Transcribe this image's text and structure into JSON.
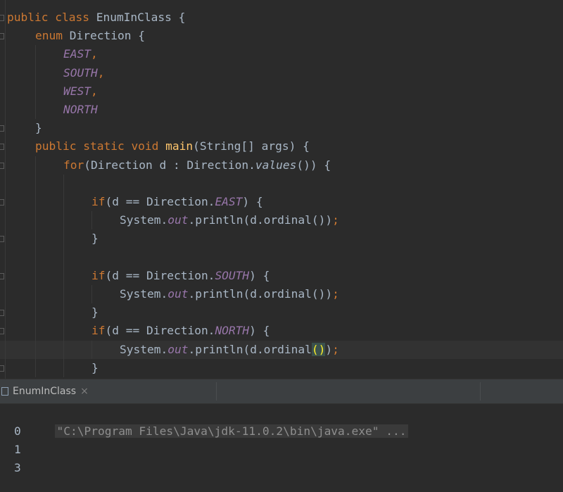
{
  "editor": {
    "lines": [
      {
        "indent": 0,
        "parts": [
          {
            "t": "public class ",
            "c": "kw"
          },
          {
            "t": "EnumInClass {",
            "c": ""
          }
        ]
      },
      {
        "indent": 1,
        "parts": [
          {
            "t": "enum ",
            "c": "kw"
          },
          {
            "t": "Direction {",
            "c": ""
          }
        ]
      },
      {
        "indent": 2,
        "parts": [
          {
            "t": "EAST",
            "c": "enumc"
          },
          {
            "t": ",",
            "c": "punct-semi"
          }
        ]
      },
      {
        "indent": 2,
        "parts": [
          {
            "t": "SOUTH",
            "c": "enumc"
          },
          {
            "t": ",",
            "c": "punct-semi"
          }
        ]
      },
      {
        "indent": 2,
        "parts": [
          {
            "t": "WEST",
            "c": "enumc"
          },
          {
            "t": ",",
            "c": "punct-semi"
          }
        ]
      },
      {
        "indent": 2,
        "parts": [
          {
            "t": "NORTH",
            "c": "enumc"
          }
        ]
      },
      {
        "indent": 1,
        "parts": [
          {
            "t": "}",
            "c": ""
          }
        ]
      },
      {
        "indent": 1,
        "parts": [
          {
            "t": "public static void ",
            "c": "kw"
          },
          {
            "t": "main",
            "c": "mdecl"
          },
          {
            "t": "(String[] args) {",
            "c": ""
          }
        ]
      },
      {
        "indent": 2,
        "parts": [
          {
            "t": "for",
            "c": "kw"
          },
          {
            "t": "(Direction d : Direction.",
            "c": ""
          },
          {
            "t": "values",
            "c": "sfn"
          },
          {
            "t": "()) {",
            "c": ""
          }
        ]
      },
      {
        "indent": 0,
        "parts": []
      },
      {
        "indent": 3,
        "parts": [
          {
            "t": "if",
            "c": "kw"
          },
          {
            "t": "(d == Direction.",
            "c": ""
          },
          {
            "t": "EAST",
            "c": "enumc"
          },
          {
            "t": ") {",
            "c": ""
          }
        ]
      },
      {
        "indent": 4,
        "parts": [
          {
            "t": "System.",
            "c": ""
          },
          {
            "t": "out",
            "c": "field"
          },
          {
            "t": ".println(d.ordinal())",
            "c": ""
          },
          {
            "t": ";",
            "c": "punct-semi"
          }
        ]
      },
      {
        "indent": 3,
        "parts": [
          {
            "t": "}",
            "c": ""
          }
        ]
      },
      {
        "indent": 0,
        "parts": []
      },
      {
        "indent": 3,
        "parts": [
          {
            "t": "if",
            "c": "kw"
          },
          {
            "t": "(d == Direction.",
            "c": ""
          },
          {
            "t": "SOUTH",
            "c": "enumc"
          },
          {
            "t": ") {",
            "c": ""
          }
        ]
      },
      {
        "indent": 4,
        "parts": [
          {
            "t": "System.",
            "c": ""
          },
          {
            "t": "out",
            "c": "field"
          },
          {
            "t": ".println(d.ordinal())",
            "c": ""
          },
          {
            "t": ";",
            "c": "punct-semi"
          }
        ]
      },
      {
        "indent": 3,
        "parts": [
          {
            "t": "}",
            "c": ""
          }
        ]
      },
      {
        "indent": 3,
        "parts": [
          {
            "t": "if",
            "c": "kw"
          },
          {
            "t": "(d == Direction.",
            "c": ""
          },
          {
            "t": "NORTH",
            "c": "enumc"
          },
          {
            "t": ") {",
            "c": ""
          }
        ]
      },
      {
        "indent": 4,
        "parts": [
          {
            "t": "System.",
            "c": ""
          },
          {
            "t": "out",
            "c": "field"
          },
          {
            "t": ".println(d.ordinal",
            "c": ""
          },
          {
            "t": "()",
            "c": "brace-hl"
          },
          {
            "t": ")",
            "c": ""
          },
          {
            "t": ";",
            "c": "punct-semi"
          }
        ]
      },
      {
        "indent": 3,
        "parts": [
          {
            "t": "}",
            "c": ""
          }
        ]
      }
    ]
  },
  "run_panel": {
    "tab_label": "EnumInClass",
    "tab_close": "×",
    "command": "\"C:\\Program Files\\Java\\jdk-11.0.2\\bin\\java.exe\" ...",
    "output": [
      "0",
      "1",
      "3"
    ]
  },
  "colors": {
    "background": "#2b2b2b",
    "keyword": "#cc7832",
    "enum_constant": "#9876aa",
    "method_decl": "#ffc66d",
    "text": "#a9b7c6"
  }
}
